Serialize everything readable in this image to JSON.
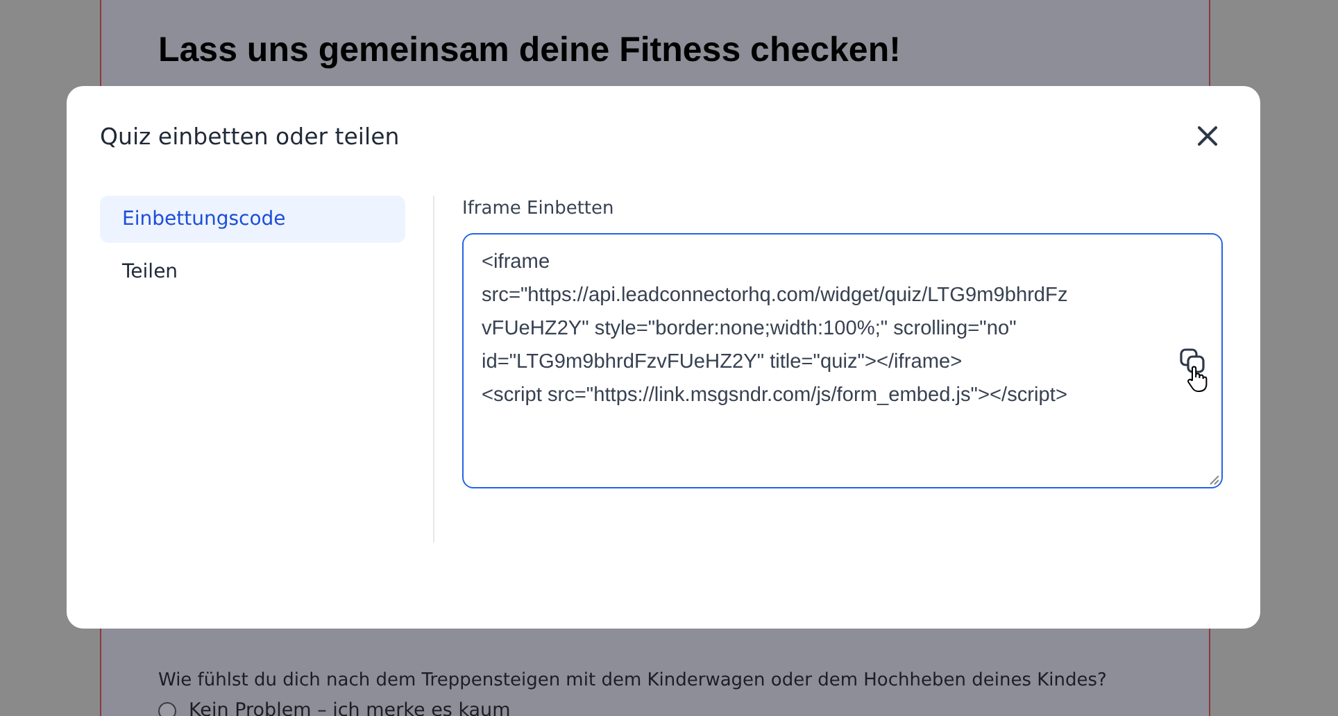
{
  "background_page": {
    "heading": "Lass uns gemeinsam deine Fitness checken!",
    "question": "Wie fühlst du dich nach dem Treppensteigen mit dem Kinderwagen oder dem Hochheben deines Kindes?",
    "options": [
      {
        "label": "Kein Problem – ich merke es kaum",
        "selected": false
      }
    ]
  },
  "dialog": {
    "title": "Quiz einbetten oder teilen",
    "sidebar": {
      "items": [
        {
          "label": "Einbettungscode",
          "selected": true
        },
        {
          "label": "Teilen",
          "selected": false
        }
      ]
    },
    "field": {
      "label": "Iframe Einbetten",
      "value": "<iframe\nsrc=\"https://api.leadconnectorhq.com/widget/quiz/LTG9m9bhrdFz\nvFUeHZ2Y\" style=\"border:none;width:100%;\" scrolling=\"no\"\nid=\"LTG9m9bhrdFzvFUeHZ2Y\" title=\"quiz\"></iframe>\n<script src=\"https://link.msgsndr.com/js/form_embed.js\"></script>"
    }
  }
}
